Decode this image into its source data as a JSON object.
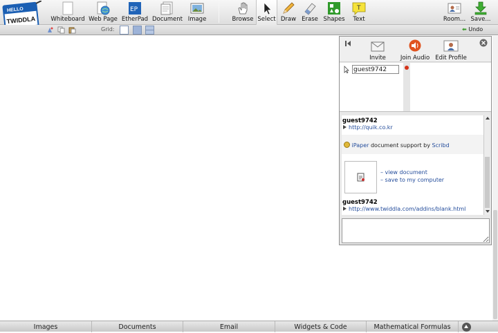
{
  "logo": {
    "line1": "HELLO",
    "line2": "TWIDDLA"
  },
  "toolbar": {
    "items": [
      {
        "label": "Whiteboard",
        "icon": "whiteboard-icon"
      },
      {
        "label": "Web Page",
        "icon": "web-page-icon"
      },
      {
        "label": "EtherPad",
        "icon": "etherpad-icon",
        "icon_text": "EP"
      },
      {
        "label": "Document",
        "icon": "document-icon"
      },
      {
        "label": "Image",
        "icon": "image-icon"
      },
      {
        "label": "Browse",
        "icon": "hand-icon"
      },
      {
        "label": "Select",
        "icon": "arrow-cursor-icon"
      },
      {
        "label": "Draw",
        "icon": "pencil-icon"
      },
      {
        "label": "Erase",
        "icon": "eraser-icon"
      },
      {
        "label": "Shapes",
        "icon": "shapes-icon"
      },
      {
        "label": "Text",
        "icon": "text-icon",
        "icon_text": "T"
      },
      {
        "label": "Room...",
        "icon": "room-icon"
      },
      {
        "label": "Save...",
        "icon": "save-icon"
      }
    ],
    "active": "Select",
    "grid_label": "Grid:",
    "undo_label": "Undo"
  },
  "panel": {
    "invite_label": "Invite",
    "join_audio_label": "Join Audio",
    "edit_profile_label": "Edit Profile",
    "user_name": "guest9742",
    "chat": [
      {
        "user": "guest9742",
        "link": "http://quik.co.kr"
      },
      {
        "user": "guest9742",
        "link": "http://www.twiddla.com/addins/blank.html"
      }
    ],
    "ipaper": {
      "brand": "iPaper",
      "text": " document support by ",
      "provider": "Scribd"
    },
    "doc_links": {
      "view": "– view document",
      "save": "– save to my computer"
    }
  },
  "bottom_tabs": [
    "Images",
    "Documents",
    "Email",
    "Widgets & Code",
    "Mathematical Formulas"
  ],
  "colors": {
    "link": "#234c9b",
    "accent_red": "#d4331a",
    "toolbar_bg": "#e3e3e3"
  }
}
